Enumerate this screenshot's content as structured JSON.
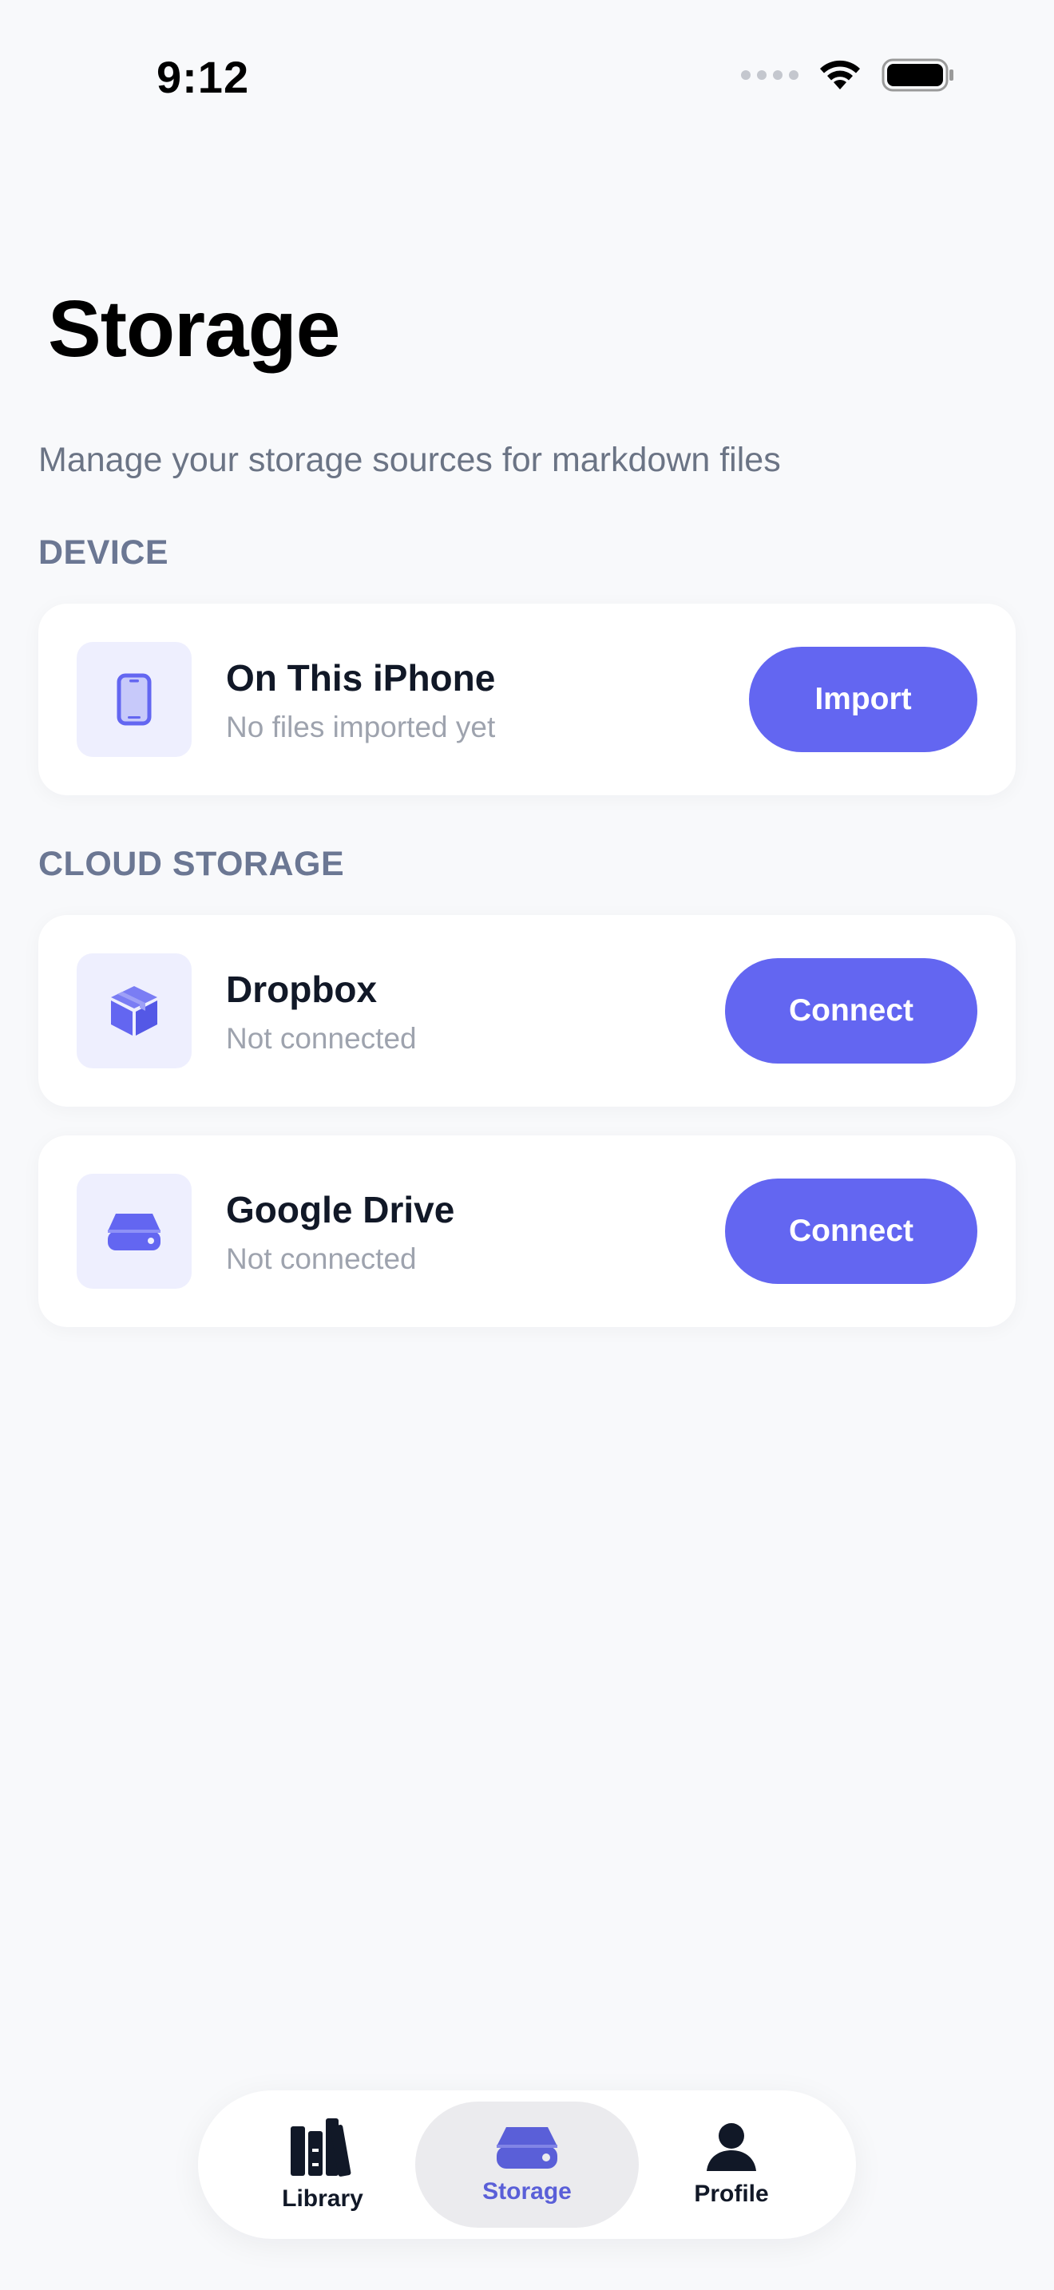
{
  "status_bar": {
    "time": "9:12"
  },
  "page": {
    "title": "Storage",
    "subtitle": "Manage your storage sources for markdown files"
  },
  "sections": {
    "device": {
      "header": "DEVICE",
      "items": [
        {
          "title": "On This iPhone",
          "subtitle": "No files imported yet",
          "button": "Import",
          "icon": "iphone-icon"
        }
      ]
    },
    "cloud": {
      "header": "CLOUD STORAGE",
      "items": [
        {
          "title": "Dropbox",
          "subtitle": "Not connected",
          "button": "Connect",
          "icon": "dropbox-box-icon"
        },
        {
          "title": "Google Drive",
          "subtitle": "Not connected",
          "button": "Connect",
          "icon": "drive-icon"
        }
      ]
    }
  },
  "tab_bar": {
    "tabs": [
      {
        "label": "Library",
        "icon": "books-icon",
        "active": false
      },
      {
        "label": "Storage",
        "icon": "drive-icon",
        "active": true
      },
      {
        "label": "Profile",
        "icon": "person-icon",
        "active": false
      }
    ]
  },
  "colors": {
    "accent": "#6366F1",
    "background": "#F8F9FB",
    "card": "#FFFFFF",
    "icon_tile": "#EEEFFE",
    "section_header": "#6B7793",
    "muted_text": "#9EA3AE",
    "active_tab": "#EBEBEE"
  }
}
